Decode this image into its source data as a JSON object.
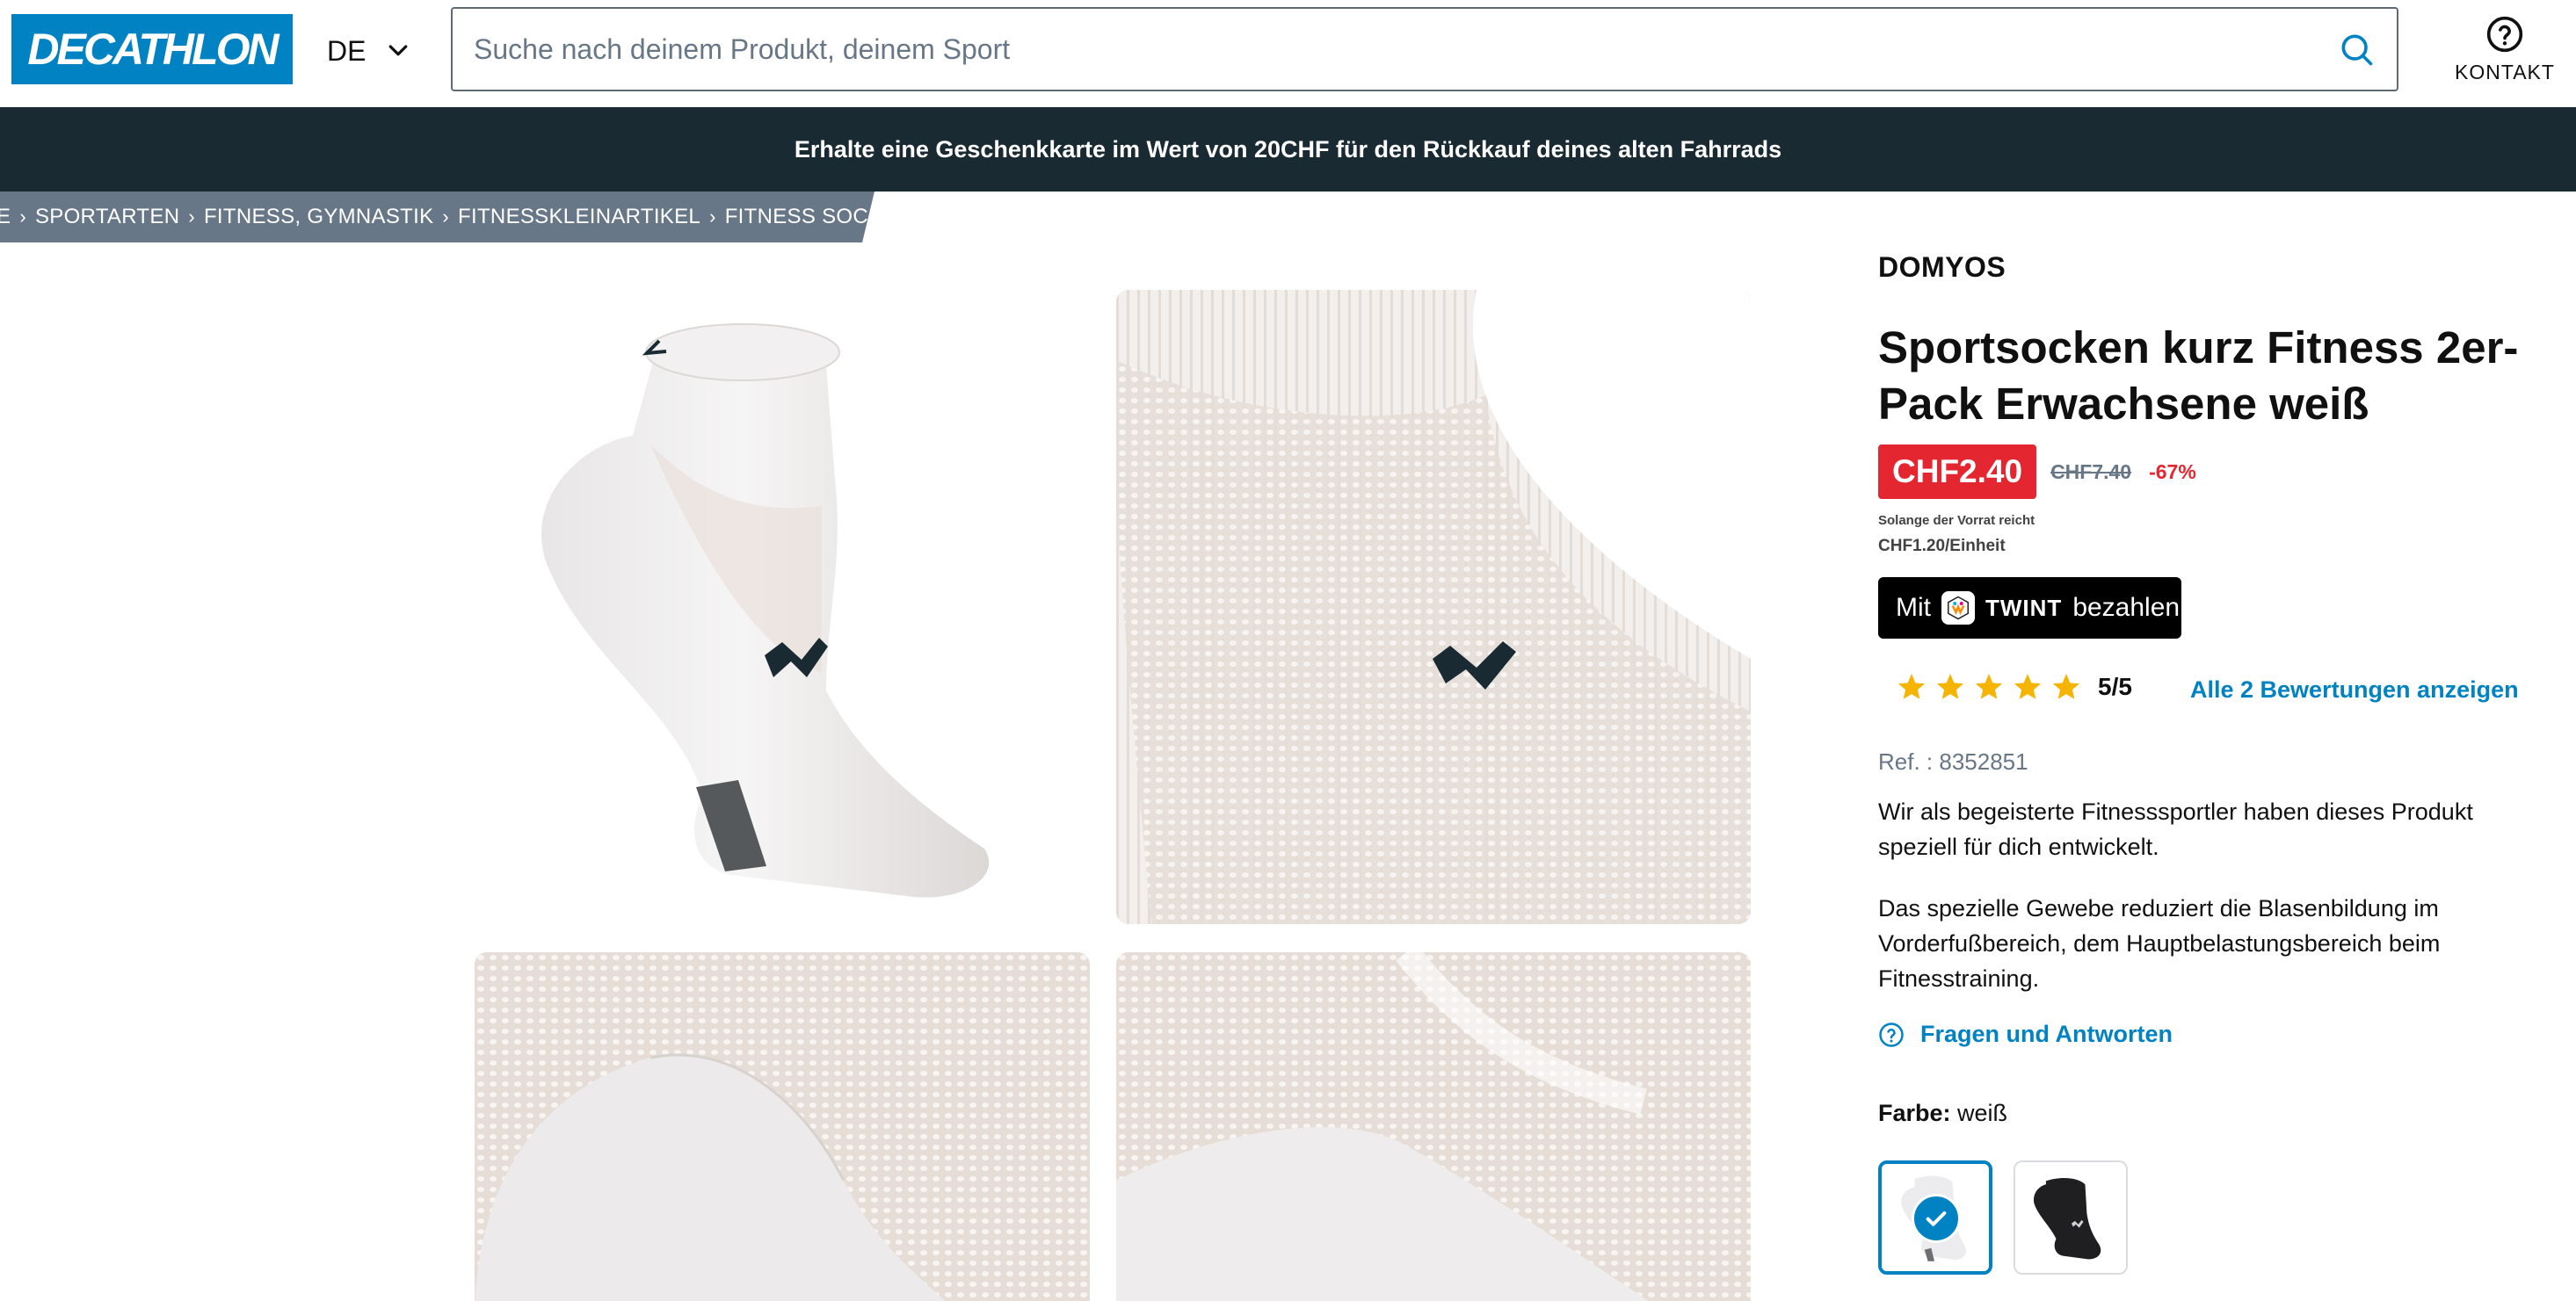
{
  "header": {
    "logo_text": "DECATHLON",
    "language": "DE",
    "search_placeholder": "Suche nach deinem Produkt, deinem Sport",
    "contact_label": "KONTAKT"
  },
  "banner": {
    "text": "Erhalte eine Geschenkkarte im Wert von 20CHF für den Rückkauf deines alten Fahrrads"
  },
  "breadcrumb": {
    "items": [
      "E",
      "SPORTARTEN",
      "FITNESS, GYMNASTIK",
      "FITNESSKLEINARTIKEL",
      "FITNESS SOCKEN"
    ]
  },
  "product": {
    "brand": "DOMYOS",
    "title": "Sportsocken kurz Fitness 2er-Pack Erwachsene weiß",
    "price": "CHF2.40",
    "old_price": "CHF7.40",
    "discount": "-67%",
    "stock_note": "Solange der Vorrat reicht",
    "unit_price": "CHF1.20/Einheit",
    "twint": {
      "prefix": "Mit",
      "name": "TWINT",
      "suffix": "bezahlen"
    },
    "rating": {
      "value": "5/5",
      "stars": 5,
      "reviews_link": "Alle 2 Bewertungen anzeigen"
    },
    "ref": "Ref. : 8352851",
    "description_1": "Wir als begeisterte Fitnesssportler haben dieses Produkt speziell für dich entwickelt.",
    "description_2": "Das spezielle Gewebe reduziert die Blasenbildung im Vorderfußbereich, dem Hauptbelastungsbereich beim Fitnesstraining.",
    "faq_link": "Fragen und Antworten",
    "color_label": "Farbe:",
    "color_value": "weiß",
    "swatches": [
      {
        "color": "weiß",
        "selected": true
      },
      {
        "color": "schwarz",
        "selected": false
      }
    ]
  },
  "colors": {
    "brand_blue": "#0082c3",
    "banner_bg": "#1a2a33",
    "price_red": "#e3262f",
    "breadcrumb_bg": "#687787",
    "star_yellow": "#f5b400"
  },
  "icons": {
    "search": "search-icon",
    "contact": "help-circle-icon",
    "language": "chevron-down-icon",
    "faq": "question-circle-icon",
    "check": "check-icon"
  }
}
